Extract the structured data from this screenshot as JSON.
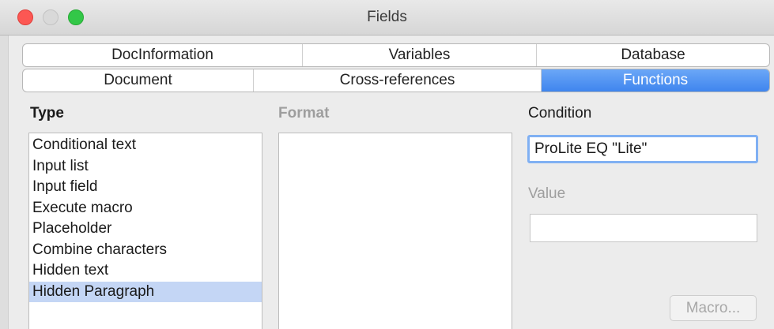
{
  "window": {
    "title": "Fields"
  },
  "tabs": {
    "row1": [
      {
        "label": "DocInformation"
      },
      {
        "label": "Variables"
      },
      {
        "label": "Database"
      }
    ],
    "row2": [
      {
        "label": "Document"
      },
      {
        "label": "Cross-references"
      },
      {
        "label": "Functions",
        "active": true
      }
    ]
  },
  "type": {
    "label": "Type",
    "items": [
      "Conditional text",
      "Input list",
      "Input field",
      "Execute macro",
      "Placeholder",
      "Combine characters",
      "Hidden text",
      "Hidden Paragraph"
    ],
    "selected": "Hidden Paragraph"
  },
  "format": {
    "label": "Format",
    "items": []
  },
  "condition": {
    "label": "Condition",
    "value": "ProLite EQ \"Lite\""
  },
  "value_field": {
    "label": "Value",
    "value": ""
  },
  "buttons": {
    "macro": "Macro..."
  },
  "colors": {
    "accent": "#3f85ee",
    "selection": "#c4d6f5",
    "focus_ring": "#80b0f3",
    "disabled_text": "#9e9e9e"
  }
}
